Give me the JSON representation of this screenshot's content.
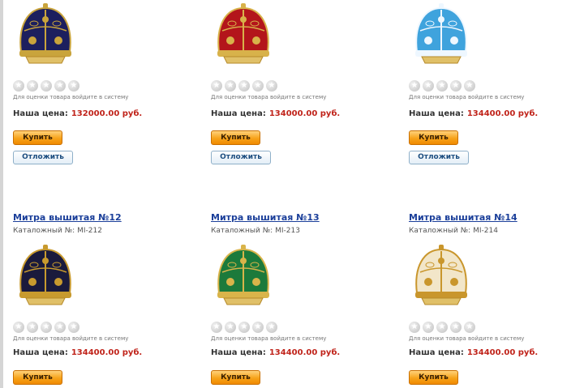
{
  "price_label": "Наша цена:",
  "rating_hint": "Для оценки товара войдите в систему",
  "buy_label": "Купить",
  "defer_label": "Отложить",
  "catalog_label": "Каталожный №:",
  "products": [
    {
      "title": "",
      "catalog_no": "",
      "price": "132000.00 руб.",
      "color": "#1c1f5e",
      "accent": "#c9a43c",
      "icon": "mitre-icon"
    },
    {
      "title": "",
      "catalog_no": "",
      "price": "134000.00 руб.",
      "color": "#b3151b",
      "accent": "#d8b24a",
      "icon": "mitre-icon"
    },
    {
      "title": "",
      "catalog_no": "",
      "price": "134400.00 руб.",
      "color": "#3fa3dd",
      "accent": "#eef7ff",
      "icon": "mitre-icon"
    },
    {
      "title": "Митра вышитая №12",
      "catalog_no": "MI-212",
      "price": "134400.00 руб.",
      "color": "#1a1a3c",
      "accent": "#c89a2e",
      "icon": "mitre-icon"
    },
    {
      "title": "Митра вышитая №13",
      "catalog_no": "MI-213",
      "price": "134400.00 руб.",
      "color": "#1c7a3b",
      "accent": "#d9b44a",
      "icon": "mitre-icon"
    },
    {
      "title": "Митра вышитая №14",
      "catalog_no": "MI-214",
      "price": "134400.00 руб.",
      "color": "#f2e6c9",
      "accent": "#c9962c",
      "icon": "mitre-icon"
    }
  ]
}
